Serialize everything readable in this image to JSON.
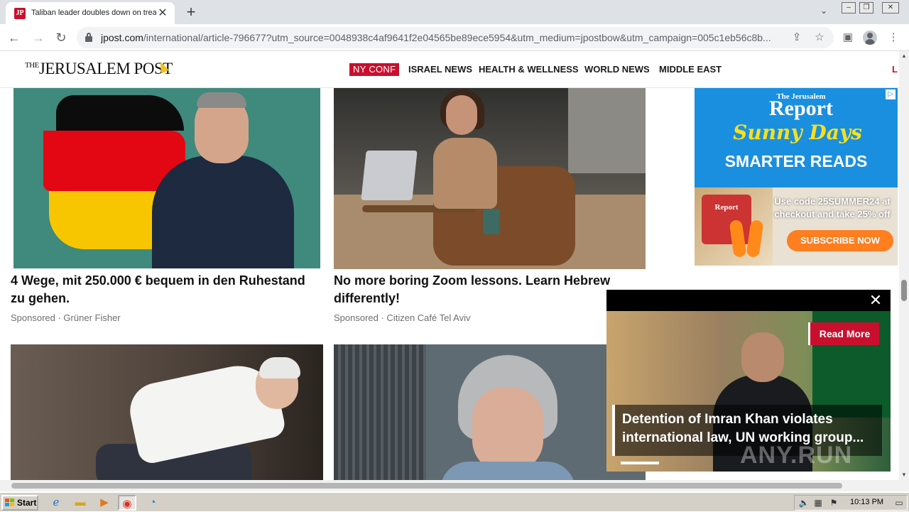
{
  "browser": {
    "tab_title": "Taliban leader doubles down on treat",
    "tab_favicon_text": "JP",
    "url_host": "jpost.com",
    "url_path": "/international/article-796677?utm_source=0048938c4af9641f2e04565be89ece5954&utm_medium=jpostbow&utm_campaign=005c1eb56c8b...",
    "tab_menu_icon": "chevron-down-icon"
  },
  "site": {
    "logo_the": "THE",
    "logo_name": "JERUSALEM POST",
    "nav": [
      {
        "label": "NY CONF"
      },
      {
        "label": "ISRAEL NEWS"
      },
      {
        "label": "HEALTH & WELLNESS"
      },
      {
        "label": "WORLD NEWS"
      },
      {
        "label": "MIDDLE EAST"
      },
      {
        "label": "L"
      }
    ]
  },
  "cards": [
    {
      "title": "4 Wege, mit 250.000 € bequem in den Ruhestand zu gehen.",
      "meta": "Sponsored · Grüner Fisher"
    },
    {
      "title": "No more boring Zoom lessons. Learn Hebrew differently!",
      "meta": "Sponsored · Citizen Café Tel Aviv"
    }
  ],
  "ad": {
    "brand_small": "The Jerusalem",
    "brand": "Report",
    "headline": "Sunny Days",
    "subhead": "SMARTER READS",
    "promo": "Use code 25SUMMER24 at checkout and take 25% off",
    "cta": "SUBSCRIBE NOW",
    "bag_label": "Report"
  },
  "video": {
    "read_more": "Read More",
    "caption": "Detention of Imran Khan violates international law, UN working group...",
    "watermark": "ANY.RUN",
    "progress": 0.14
  },
  "taskbar": {
    "start_label": "Start",
    "clock": "10:13 PM"
  },
  "colors": {
    "brand_red": "#c8102e",
    "ad_blue": "#1a8fe0",
    "ad_yellow": "#f7e01c",
    "cta_orange": "#ff7e1f"
  }
}
